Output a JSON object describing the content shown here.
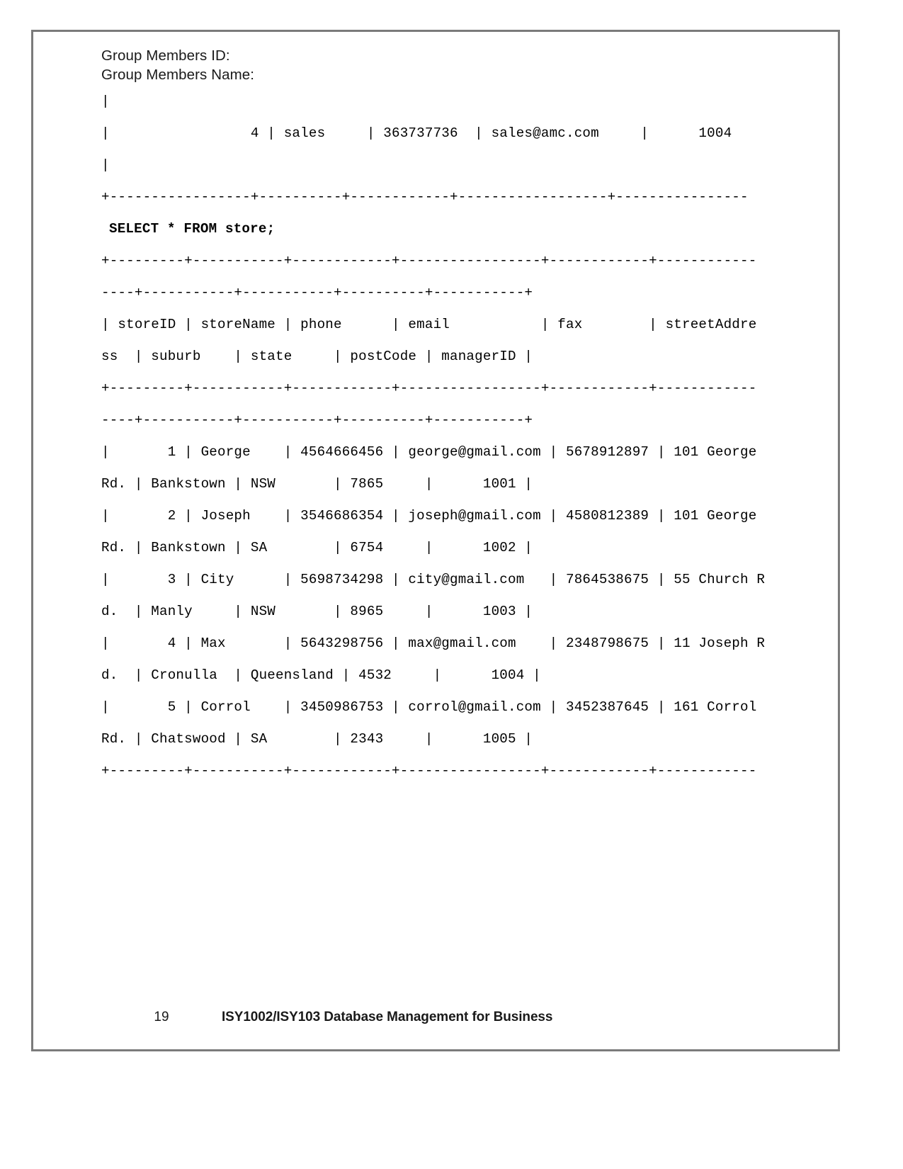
{
  "document": {
    "header_lines": [
      "Group Members ID:",
      "Group Members Name:"
    ],
    "console": {
      "lines": [
        "|",
        "|                 4 | sales     | 363737736  | sales@amc.com     |      1004",
        "|",
        "+-----------------+----------+------------+------------------+----------------",
        "SELECT * FROM store;",
        "+---------+-----------+------------+-----------------+------------+------------",
        "----+-----------+-----------+----------+-----------+",
        "| storeID | storeName | phone      | email           | fax        | streetAddre",
        "ss  | suburb    | state     | postCode | managerID |",
        "+---------+-----------+------------+-----------------+------------+------------",
        "----+-----------+-----------+----------+-----------+",
        "|       1 | George    | 4564666456 | george@gmail.com | 5678912897 | 101 George",
        "Rd. | Bankstown | NSW       | 7865     |      1001 |",
        "|       2 | Joseph    | 3546686354 | joseph@gmail.com | 4580812389 | 101 George",
        "Rd. | Bankstown | SA        | 6754     |      1002 |",
        "|       3 | City      | 5698734298 | city@gmail.com   | 7864538675 | 55 Church R",
        "d.  | Manly     | NSW       | 8965     |      1003 |",
        "|       4 | Max       | 5643298756 | max@gmail.com    | 2348798675 | 11 Joseph R",
        "d.  | Cronulla  | Queensland | 4532     |      1004 |",
        "|       5 | Corrol    | 3450986753 | corrol@gmail.com | 3452387645 | 161 Corrol",
        "Rd. | Chatswood | SA        | 2343     |      1005 |",
        "+---------+-----------+------------+-----------------+------------+------------"
      ],
      "sql_line_index": 4
    },
    "footer": {
      "page_number": "19",
      "course_title": "ISY1002/ISY103 Database Management for Business"
    }
  }
}
